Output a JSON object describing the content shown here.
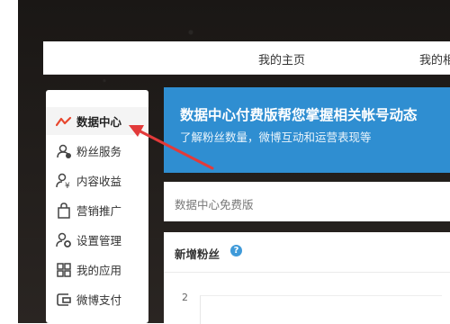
{
  "topnav": {
    "items": [
      "我的主页",
      "我的相"
    ]
  },
  "sidebar": {
    "items": [
      {
        "label": "数据中心",
        "icon": "line-chart-icon",
        "active": true
      },
      {
        "label": "粉丝服务",
        "icon": "fans-icon"
      },
      {
        "label": "内容收益",
        "icon": "revenue-icon"
      },
      {
        "label": "营销推广",
        "icon": "bag-icon"
      },
      {
        "label": "设置管理",
        "icon": "user-gear-icon"
      },
      {
        "label": "我的应用",
        "icon": "grid-icon"
      },
      {
        "label": "微博支付",
        "icon": "wallet-icon"
      }
    ]
  },
  "banner": {
    "title": "数据中心付费版帮您掌握相关帐号动态",
    "subtitle": "了解粉丝数量，微博互动和运营表现等"
  },
  "free_panel": {
    "label": "数据中心免费版"
  },
  "fans_panel": {
    "title": "新增粉丝",
    "help": "?",
    "y_tick": "2"
  },
  "colors": {
    "accent": "#2f8ed1",
    "arrow": "#e23a3a",
    "active_icon": "#e8482f"
  }
}
